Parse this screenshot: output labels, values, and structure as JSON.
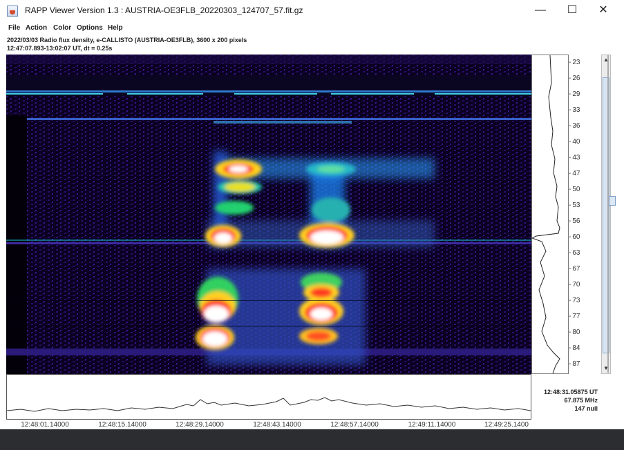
{
  "window": {
    "title": "RAPP Viewer Version 1.3 : AUSTRIA-OE3FLB_20220303_124707_57.fit.gz",
    "controls": {
      "minimize": "—",
      "maximize": "☐",
      "close": "✕"
    }
  },
  "menu": [
    "File",
    "Action",
    "Color",
    "Options",
    "Help"
  ],
  "info": {
    "line1": "2022/03/03  Radio flux density, e-CALLISTO (AUSTRIA-OE3FLB),  3600 x 200 pixels",
    "line2": "12:47:07.893-13:02:07 UT,  dt = 0.25s"
  },
  "freq_ticks": [
    "23",
    "26",
    "29",
    "33",
    "36",
    "40",
    "43",
    "47",
    "50",
    "53",
    "56",
    "60",
    "63",
    "67",
    "70",
    "73",
    "77",
    "80",
    "84",
    "87"
  ],
  "time_ticks": [
    "12:48:01.14000",
    "12:48:15.14000",
    "12:48:29.14000",
    "12:48:43.14000",
    "12:48:57.14000",
    "12:49:11.14000",
    "12:49:25.1400"
  ],
  "readout": {
    "time": "12:48:31.05875 UT",
    "frequency": "67.875 MHz",
    "value": "147 null"
  },
  "icons": {
    "app": "java-coffee-cup-icon",
    "slider": "vertical-slider-knob"
  }
}
